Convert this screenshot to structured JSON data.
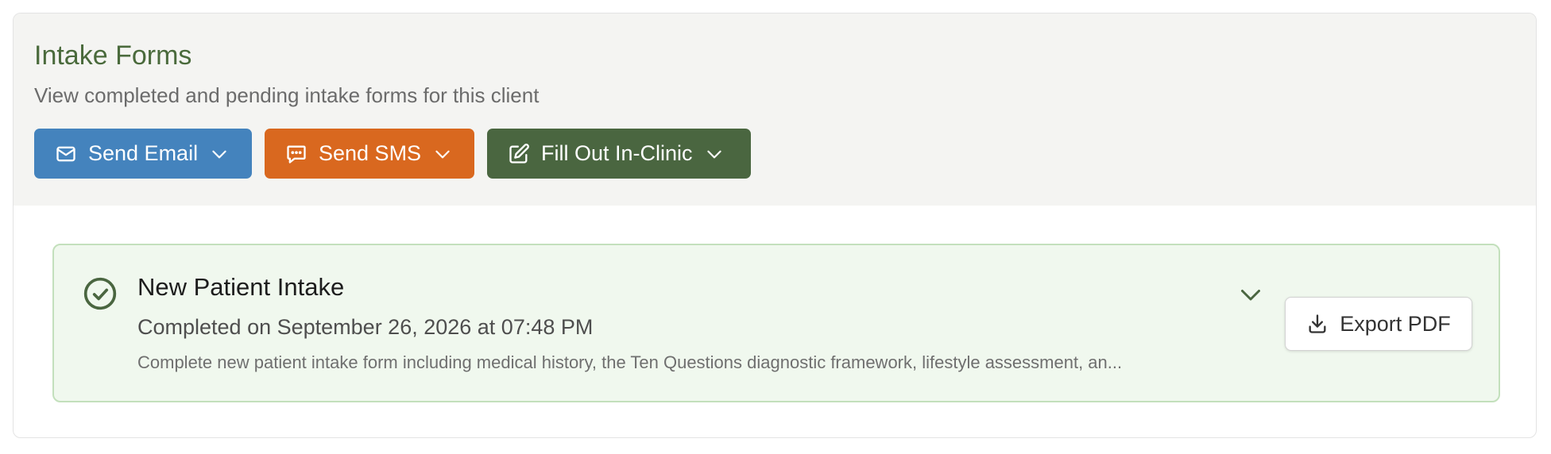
{
  "header": {
    "title": "Intake Forms",
    "subtitle": "View completed and pending intake forms for this client"
  },
  "actions": [
    {
      "label": "Send Email",
      "icon": "mail-icon",
      "color": "#4483bd"
    },
    {
      "label": "Send SMS",
      "icon": "message-icon",
      "color": "#d9681f"
    },
    {
      "label": "Fill Out In-Clinic",
      "icon": "edit-icon",
      "color": "#4a6640"
    }
  ],
  "forms": [
    {
      "title": "New Patient Intake",
      "status_icon": "check-circle-icon",
      "completed": "Completed on September 26, 2026 at 07:48 PM",
      "description": "Complete new patient intake form including medical history, the Ten Questions diagnostic framework, lifestyle assessment, an...",
      "export_label": "Export PDF"
    }
  ],
  "colors": {
    "title": "#4a6a3c",
    "form_bg": "#f0f8ee",
    "form_border": "#c3e0bc",
    "status": "#4a6640"
  }
}
